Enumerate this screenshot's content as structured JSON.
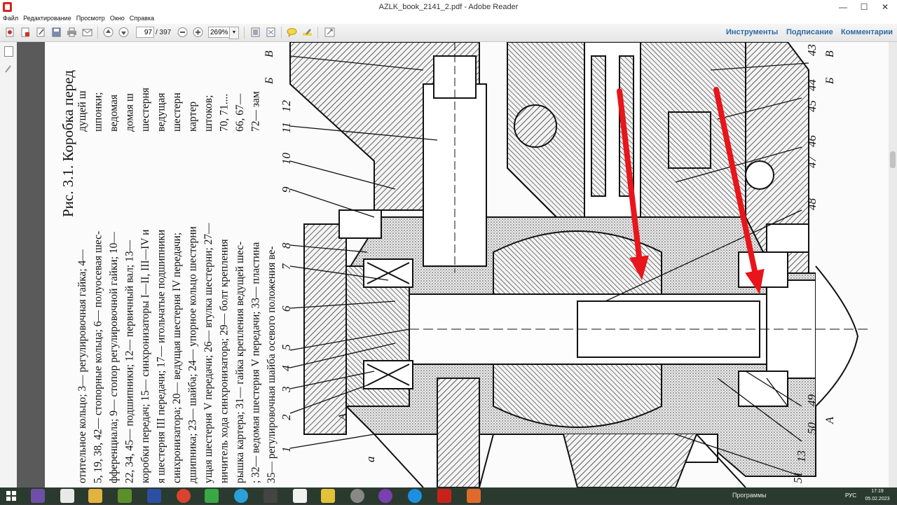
{
  "window": {
    "title": "AZLK_book_2141_2.pdf - Adobe Reader",
    "min_glyph": "—",
    "max_glyph": "☐",
    "close_glyph": "✕"
  },
  "menu": [
    "Файл",
    "Редактирование",
    "Просмотр",
    "Окно",
    "Справка"
  ],
  "toolbar": {
    "page_current": "97",
    "page_total": "/ 397",
    "zoom": "269%",
    "links": [
      "Инструменты",
      "Подписание",
      "Комментарии"
    ]
  },
  "document": {
    "caption": {
      "title": "Рис. 3.1. Коробка перед",
      "lines": [
        "отительное кольцо; 3— регулировочная гайка; 4—",
        "5, 19, 38, 42— стопорные кольца; 6— полуосевая шес-",
        "фференциала; 9— стопор регулировочной гайки; 10—",
        "22, 34, 45— подшипники; 12— первичный вал; 13—",
        "коробки передач; 15— синхронизаторы I—II, III—IV и",
        "я шестерня III передачи; 17— игольчатые подшипники",
        "синхронизатора; 20— ведущая шестерня IV передачи;",
        "дшипника; 23— шайба; 24— упорное кольцо шестерни",
        "ущая шестерня V передачи; 26— втулка шестерни; 27—",
        "ничитель хода синхронизатора; 29— болт крепления",
        "рышка картера; 31— гайка крепления ведущей шес-",
        "; 32— ведомая шестерня V передачи; 33— пластина",
        "35— регулировочная шайба осевого положения ве-"
      ],
      "right_column": [
        "дущей ш",
        "шпонки;",
        "ведомая",
        "домая ш",
        "шестерня",
        "ведущая",
        "шестерн",
        "картер",
        "штоков;",
        "70, 71....",
        "66, 67—",
        "72— зам"
      ]
    },
    "callouts": [
      "1",
      "2",
      "3",
      "4",
      "5",
      "6",
      "7",
      "8",
      "9",
      "10",
      "11",
      "12",
      "13",
      "43",
      "44",
      "45",
      "46",
      "47",
      "48",
      "49",
      "50",
      "51",
      "а"
    ],
    "section_marks": [
      "Б",
      "В",
      "Б",
      "В",
      "А",
      "А"
    ],
    "arrow_color": "#e8151b"
  },
  "taskbar": {
    "tray_label": "Программы",
    "language": "РУС",
    "time": "17:19",
    "date": "05.02.2023"
  },
  "colors": {
    "toolbar_link": "#2d6aa3",
    "taskbar": "#2b3a2e"
  }
}
